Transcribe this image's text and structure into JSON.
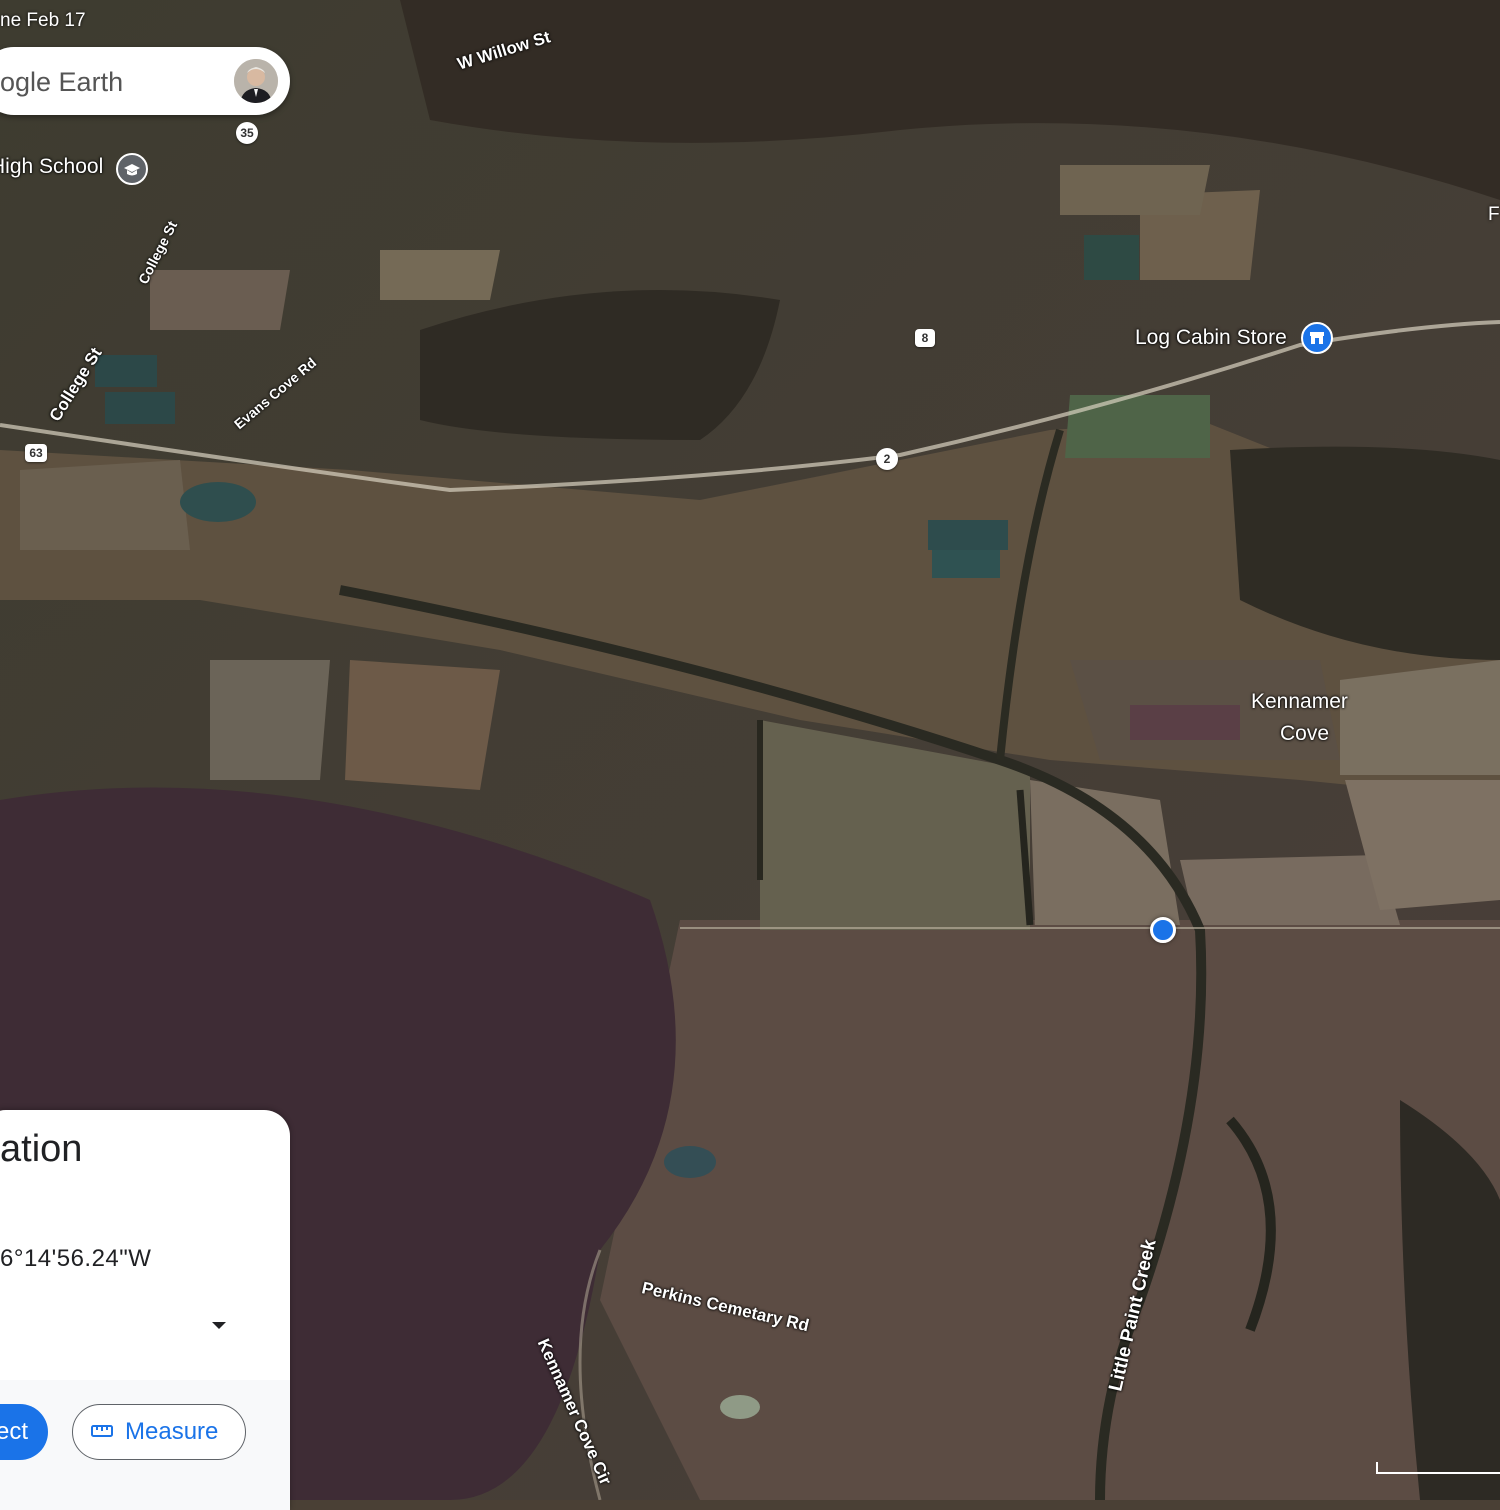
{
  "window": {
    "date_text": "ne Feb 17"
  },
  "search": {
    "text": "ogle Earth"
  },
  "map": {
    "roads": [
      {
        "key": "willow",
        "text": "W Willow St"
      },
      {
        "key": "college1",
        "text": "College St"
      },
      {
        "key": "college2",
        "text": "College St"
      },
      {
        "key": "evans",
        "text": "Evans Cove Rd"
      },
      {
        "key": "perkins",
        "text": "Perkins Cemetary Rd"
      },
      {
        "key": "kennamer_cir",
        "text": "Kennamer Cove Cir"
      },
      {
        "key": "creek",
        "text": "Little Paint Creek"
      }
    ],
    "shields": [
      "35",
      "8",
      "63",
      "2"
    ],
    "places": {
      "high_school": "High School",
      "log_cabin": "Log Cabin Store",
      "kennamer_1": "Kennamer",
      "kennamer_2": "Cove"
    },
    "edge_letter": "F"
  },
  "panel": {
    "title": "ation",
    "coords": "6°14'56.24\"W",
    "select_label": "ect",
    "measure_label": "Measure"
  },
  "icons": [
    "avatar",
    "school-icon",
    "store-icon",
    "dropdown-arrow-icon",
    "ruler-icon",
    "location-dot-icon"
  ]
}
